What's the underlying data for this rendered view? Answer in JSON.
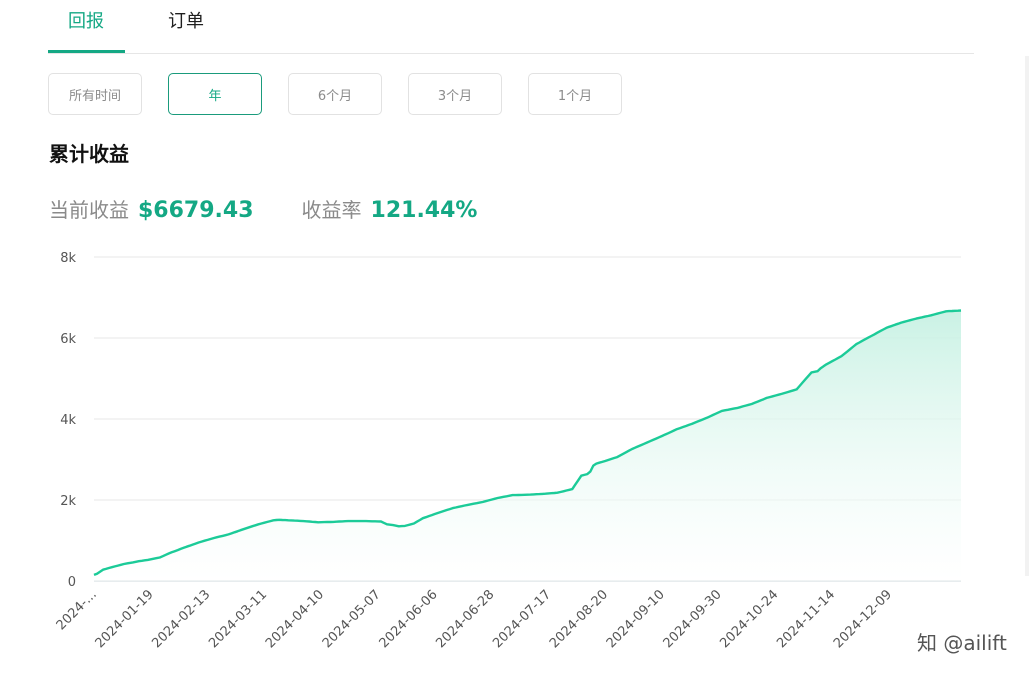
{
  "tabs": [
    {
      "label": "回报",
      "active": true
    },
    {
      "label": "订单",
      "active": false
    }
  ],
  "ranges": [
    {
      "label": "所有时间",
      "active": false
    },
    {
      "label": "年",
      "active": true
    },
    {
      "label": "6个月",
      "active": false
    },
    {
      "label": "3个月",
      "active": false
    },
    {
      "label": "1个月",
      "active": false
    }
  ],
  "section_title": "累计收益",
  "stats": {
    "current_label": "当前收益",
    "current_value": "$6679.43",
    "rate_label": "收益率",
    "rate_value": "121.44%"
  },
  "watermark": "知 @ailift",
  "colors": {
    "accent": "#14a884",
    "line": "#1ccb98",
    "area_top": "#c7f1e3",
    "grid": "#e7e7e7",
    "axis_text": "#555555"
  },
  "chart_data": {
    "type": "area",
    "ylim": [
      0,
      8000
    ],
    "y_ticks": [
      0,
      2000,
      4000,
      6000,
      8000
    ],
    "y_tick_labels": [
      "0",
      "2k",
      "4k",
      "6k",
      "8k"
    ],
    "x_tick_labels": [
      "2024-...",
      "2024-01-19",
      "2024-02-13",
      "2024-03-11",
      "2024-04-10",
      "2024-05-07",
      "2024-06-06",
      "2024-06-28",
      "2024-07-17",
      "2024-08-20",
      "2024-09-10",
      "2024-09-30",
      "2024-10-24",
      "2024-11-14",
      "2024-12-09"
    ],
    "x_tick_positions": [
      1,
      20,
      39,
      58,
      77,
      96,
      115,
      134,
      153,
      172,
      191,
      210,
      229,
      248,
      267
    ],
    "n_points": 291,
    "anchor_index": [
      0,
      1,
      3,
      5,
      8,
      10,
      13,
      15,
      18,
      22,
      25,
      30,
      35,
      40,
      45,
      50,
      55,
      60,
      62,
      65,
      70,
      75,
      80,
      85,
      90,
      96,
      98,
      100,
      102,
      104,
      107,
      110,
      115,
      120,
      125,
      130,
      135,
      140,
      145,
      150,
      155,
      160,
      163,
      164,
      165,
      166,
      167,
      168,
      169,
      170,
      175,
      180,
      185,
      190,
      195,
      200,
      205,
      210,
      215,
      220,
      225,
      230,
      235,
      240,
      242,
      243,
      245,
      250,
      255,
      260,
      265,
      270,
      275,
      280,
      285,
      290
    ],
    "anchor_value": [
      150,
      180,
      280,
      320,
      380,
      420,
      460,
      490,
      520,
      580,
      680,
      820,
      950,
      1060,
      1150,
      1280,
      1400,
      1500,
      1510,
      1500,
      1480,
      1450,
      1460,
      1480,
      1480,
      1470,
      1400,
      1380,
      1350,
      1360,
      1420,
      1550,
      1680,
      1800,
      1880,
      1950,
      2050,
      2120,
      2130,
      2150,
      2180,
      2270,
      2600,
      2620,
      2640,
      2700,
      2850,
      2900,
      2920,
      2940,
      3060,
      3260,
      3420,
      3580,
      3750,
      3880,
      4030,
      4200,
      4270,
      4370,
      4520,
      4620,
      4730,
      5150,
      5180,
      5250,
      5350,
      5550,
      5850,
      6050,
      6250,
      6380,
      6480,
      6560,
      6660,
      6679
    ]
  }
}
